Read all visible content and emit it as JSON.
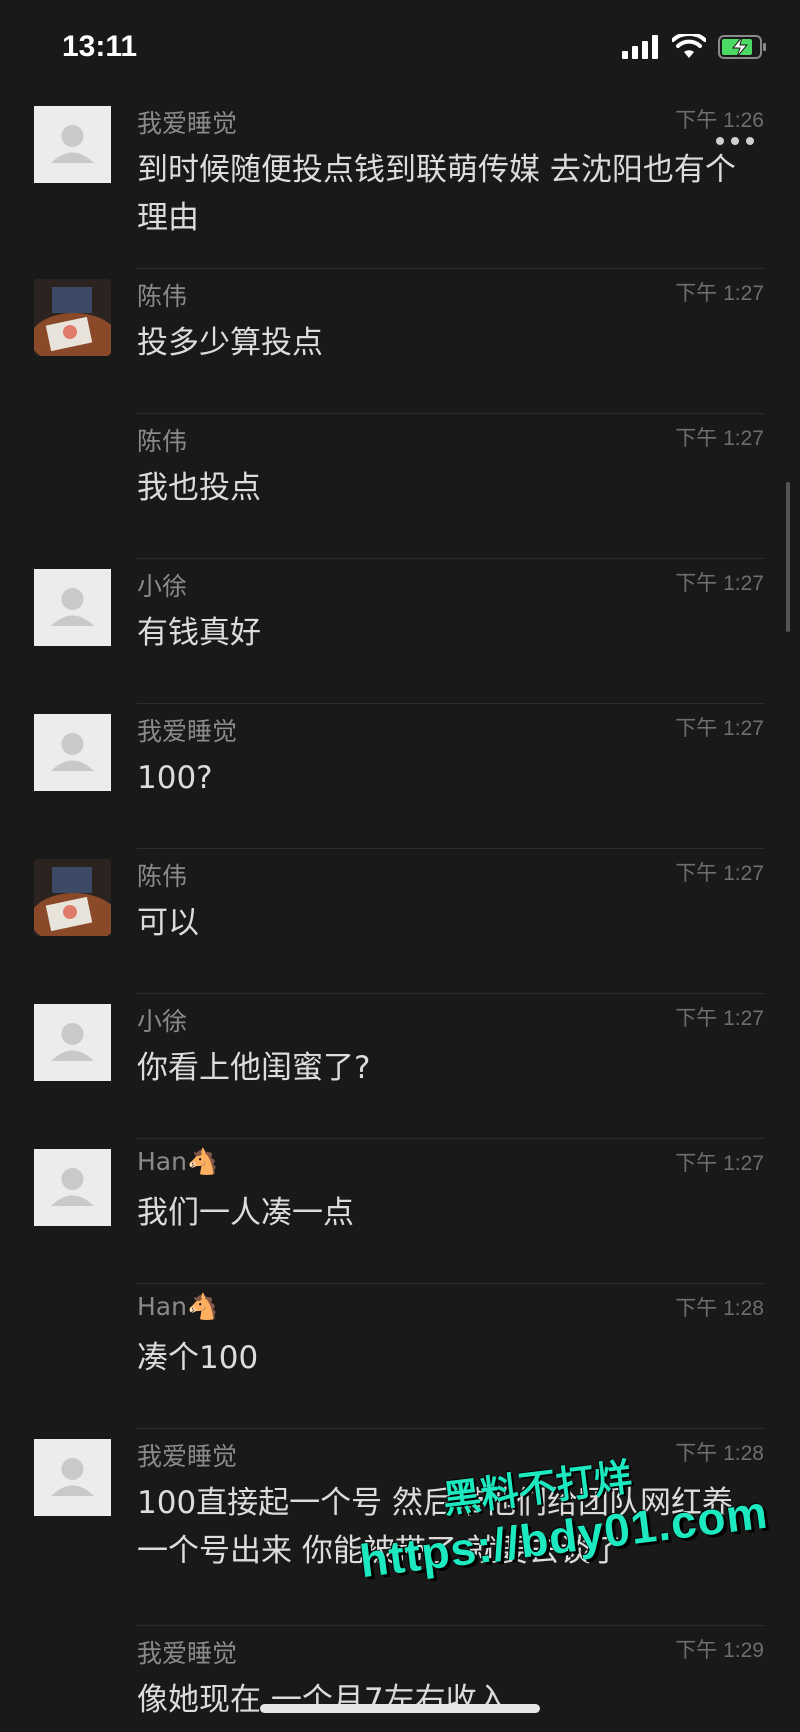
{
  "status": {
    "time": "13:11"
  },
  "messages": [
    {
      "sender": "我爱睡觉",
      "time": "下午 1:26",
      "text": "到时候随便投点钱到联萌传媒 去沈阳也有个理由",
      "avatar": "default"
    },
    {
      "sender": "陈伟",
      "time": "下午 1:27",
      "text": "投多少算投点",
      "avatar": "photo"
    },
    {
      "sender": "陈伟",
      "time": "下午 1:27",
      "text": "我也投点",
      "avatar": "none"
    },
    {
      "sender": "小徐",
      "time": "下午 1:27",
      "text": "有钱真好",
      "avatar": "default"
    },
    {
      "sender": "我爱睡觉",
      "time": "下午 1:27",
      "text": "100?",
      "avatar": "default"
    },
    {
      "sender": "陈伟",
      "time": "下午 1:27",
      "text": "可以",
      "avatar": "photo"
    },
    {
      "sender": "小徐",
      "time": "下午 1:27",
      "text": "你看上他闺蜜了?",
      "avatar": "default"
    },
    {
      "sender": "Han🐴",
      "time": "下午 1:27",
      "text": "我们一人凑一点",
      "avatar": "default"
    },
    {
      "sender": "Han🐴",
      "time": "下午 1:28",
      "text": "凑个100",
      "avatar": "none"
    },
    {
      "sender": "我爱睡觉",
      "time": "下午 1:28",
      "text": "100直接起一个号 然后带他们给团队网红养一个号出来 你能被带了 就要去谈了",
      "avatar": "default"
    },
    {
      "sender": "我爱睡觉",
      "time": "下午 1:29",
      "text": "像她现在 一个月7左右收入",
      "avatar": "none"
    }
  ],
  "watermark": {
    "line1": "黑料不打烊",
    "line2": "https://bdy01.com"
  }
}
